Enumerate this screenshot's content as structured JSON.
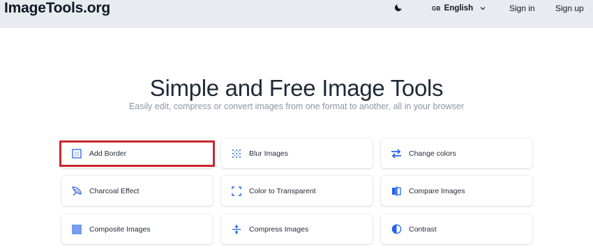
{
  "header": {
    "logo": "ImageTools.org",
    "theme_icon": "moon-icon",
    "language": {
      "flag_code": "GB",
      "label": "English"
    },
    "signin_label": "Sign in",
    "signup_label": "Sign up"
  },
  "hero": {
    "title": "Simple and Free Image Tools",
    "subtitle": "Easily edit, compress or convert images from one format to another, all in your browser"
  },
  "colors": {
    "accent": "#2563eb",
    "highlight": "#c8262d",
    "header_bg": "#e8ebef"
  },
  "tools": [
    {
      "label": "Add Border",
      "icon": "border-icon"
    },
    {
      "label": "Blur Images",
      "icon": "blur-icon"
    },
    {
      "label": "Change colors",
      "icon": "swap-arrows-icon"
    },
    {
      "label": "Charcoal Effect",
      "icon": "charcoal-icon"
    },
    {
      "label": "Color to Transparent",
      "icon": "corners-icon"
    },
    {
      "label": "Compare Images",
      "icon": "compare-icon"
    },
    {
      "label": "Composite Images",
      "icon": "composite-icon"
    },
    {
      "label": "Compress Images",
      "icon": "compress-icon"
    },
    {
      "label": "Contrast",
      "icon": "contrast-icon"
    }
  ]
}
